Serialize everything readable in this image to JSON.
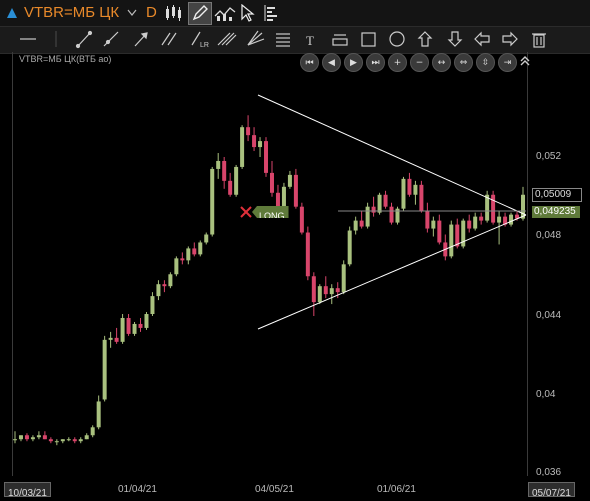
{
  "header": {
    "symbol": "VTBR=МБ ЦК",
    "interval": "D"
  },
  "chart_label": "VTBR=МБ ЦК(ВТБ ао)",
  "price_axis": {
    "ticks": [
      "0,052",
      "0,048",
      "0,044",
      "0,04",
      "0,036"
    ],
    "last_price": "0,05009",
    "marker_price": "0,049235"
  },
  "date_axis": {
    "labels": [
      "10/03/21",
      "01/04/21",
      "04/05/21",
      "01/06/21",
      "05/07/21"
    ]
  },
  "trade_marker": {
    "label": "LONG"
  },
  "colors": {
    "up": "#a9c17f",
    "down": "#d8456b",
    "line": "#ffffff",
    "accent": "#e8892a",
    "marker": "#5f7a3a"
  },
  "candles": [
    [
      0.0378,
      0.0382,
      0.0376,
      0.0378
    ],
    [
      0.0378,
      0.038,
      0.0377,
      0.038
    ],
    [
      0.038,
      0.0381,
      0.0377,
      0.0378
    ],
    [
      0.0378,
      0.038,
      0.0377,
      0.0379
    ],
    [
      0.0379,
      0.0382,
      0.0378,
      0.038
    ],
    [
      0.038,
      0.0382,
      0.0378,
      0.0378
    ],
    [
      0.0378,
      0.0379,
      0.0376,
      0.0377
    ],
    [
      0.0377,
      0.0378,
      0.0375,
      0.0377
    ],
    [
      0.0377,
      0.0378,
      0.0376,
      0.0378
    ],
    [
      0.0378,
      0.0379,
      0.0377,
      0.0378
    ],
    [
      0.0378,
      0.0379,
      0.0376,
      0.0377
    ],
    [
      0.0377,
      0.0379,
      0.0376,
      0.0378
    ],
    [
      0.0378,
      0.0381,
      0.0378,
      0.038
    ],
    [
      0.038,
      0.0385,
      0.0379,
      0.0384
    ],
    [
      0.0384,
      0.04,
      0.0383,
      0.0397
    ],
    [
      0.0398,
      0.043,
      0.0397,
      0.0428
    ],
    [
      0.0428,
      0.0432,
      0.0424,
      0.0429
    ],
    [
      0.0429,
      0.0434,
      0.0426,
      0.0427
    ],
    [
      0.0427,
      0.0441,
      0.0426,
      0.0439
    ],
    [
      0.0439,
      0.0441,
      0.043,
      0.0431
    ],
    [
      0.0431,
      0.0437,
      0.043,
      0.0436
    ],
    [
      0.0436,
      0.0439,
      0.0432,
      0.0434
    ],
    [
      0.0434,
      0.0442,
      0.0433,
      0.0441
    ],
    [
      0.0441,
      0.0452,
      0.044,
      0.045
    ],
    [
      0.045,
      0.0458,
      0.0448,
      0.0456
    ],
    [
      0.0456,
      0.0458,
      0.0452,
      0.0455
    ],
    [
      0.0455,
      0.0462,
      0.0454,
      0.0461
    ],
    [
      0.0461,
      0.047,
      0.046,
      0.0469
    ],
    [
      0.0469,
      0.0472,
      0.0466,
      0.0468
    ],
    [
      0.0468,
      0.0475,
      0.0466,
      0.0474
    ],
    [
      0.0474,
      0.0477,
      0.047,
      0.0471
    ],
    [
      0.0471,
      0.0478,
      0.047,
      0.0477
    ],
    [
      0.0477,
      0.0482,
      0.0476,
      0.0481
    ],
    [
      0.0481,
      0.0515,
      0.048,
      0.0514
    ],
    [
      0.0514,
      0.0522,
      0.0509,
      0.0518
    ],
    [
      0.0518,
      0.052,
      0.0504,
      0.0508
    ],
    [
      0.0508,
      0.0512,
      0.05,
      0.0501
    ],
    [
      0.0501,
      0.0516,
      0.05,
      0.0515
    ],
    [
      0.0515,
      0.0536,
      0.0514,
      0.0535
    ],
    [
      0.0535,
      0.0541,
      0.0528,
      0.0531
    ],
    [
      0.0531,
      0.0535,
      0.0523,
      0.0525
    ],
    [
      0.0525,
      0.053,
      0.052,
      0.0528
    ],
    [
      0.0528,
      0.053,
      0.051,
      0.0512
    ],
    [
      0.0512,
      0.0518,
      0.05,
      0.0502
    ],
    [
      0.0502,
      0.0506,
      0.049,
      0.0493
    ],
    [
      0.0493,
      0.0507,
      0.0492,
      0.0505
    ],
    [
      0.0505,
      0.0513,
      0.0504,
      0.0511
    ],
    [
      0.0511,
      0.0514,
      0.0494,
      0.0495
    ],
    [
      0.0495,
      0.0497,
      0.0481,
      0.0482
    ],
    [
      0.0482,
      0.0485,
      0.0458,
      0.046
    ],
    [
      0.046,
      0.0462,
      0.044,
      0.0447
    ],
    [
      0.0447,
      0.0456,
      0.0446,
      0.0455
    ],
    [
      0.0455,
      0.046,
      0.0449,
      0.0451
    ],
    [
      0.0451,
      0.0456,
      0.0446,
      0.0454
    ],
    [
      0.0454,
      0.0457,
      0.0449,
      0.0452
    ],
    [
      0.0452,
      0.0468,
      0.0451,
      0.0466
    ],
    [
      0.0466,
      0.0485,
      0.0465,
      0.0483
    ],
    [
      0.0483,
      0.049,
      0.0481,
      0.0488
    ],
    [
      0.0488,
      0.0493,
      0.0484,
      0.0485
    ],
    [
      0.0485,
      0.0497,
      0.0484,
      0.0495
    ],
    [
      0.0495,
      0.05,
      0.049,
      0.0492
    ],
    [
      0.0492,
      0.0502,
      0.0491,
      0.0501
    ],
    [
      0.0501,
      0.0503,
      0.0494,
      0.0495
    ],
    [
      0.0495,
      0.0497,
      0.0486,
      0.0487
    ],
    [
      0.0487,
      0.0495,
      0.0486,
      0.0494
    ],
    [
      0.0494,
      0.051,
      0.0493,
      0.0509
    ],
    [
      0.0509,
      0.0512,
      0.05,
      0.0501
    ],
    [
      0.0501,
      0.0508,
      0.0496,
      0.0506
    ],
    [
      0.0506,
      0.0508,
      0.0492,
      0.0493
    ],
    [
      0.0493,
      0.0497,
      0.0482,
      0.0484
    ],
    [
      0.0484,
      0.049,
      0.048,
      0.0488
    ],
    [
      0.0488,
      0.0491,
      0.0476,
      0.0477
    ],
    [
      0.0477,
      0.0481,
      0.0468,
      0.047
    ],
    [
      0.047,
      0.0488,
      0.0469,
      0.0486
    ],
    [
      0.0486,
      0.0489,
      0.0474,
      0.0475
    ],
    [
      0.0475,
      0.0489,
      0.0474,
      0.0488
    ],
    [
      0.0488,
      0.0491,
      0.0482,
      0.0484
    ],
    [
      0.0484,
      0.0492,
      0.0483,
      0.049
    ],
    [
      0.049,
      0.0492,
      0.0486,
      0.0488
    ],
    [
      0.0488,
      0.0503,
      0.0487,
      0.0501
    ],
    [
      0.0501,
      0.0503,
      0.0486,
      0.0487
    ],
    [
      0.0487,
      0.0493,
      0.0476,
      0.049
    ],
    [
      0.049,
      0.0492,
      0.0485,
      0.0486
    ],
    [
      0.0486,
      0.0492,
      0.0485,
      0.0491
    ],
    [
      0.0491,
      0.0493,
      0.0488,
      0.0489
    ],
    [
      0.0489,
      0.0505,
      0.0488,
      0.0501
    ]
  ]
}
